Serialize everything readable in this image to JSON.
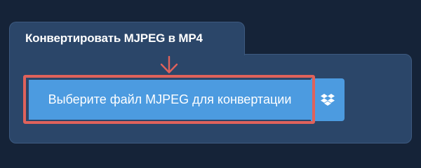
{
  "converter": {
    "title": "Конвертировать MJPEG в MP4",
    "choose_file_label": "Выберите файл MJPEG для конвертации",
    "dropbox_icon": "dropbox-icon",
    "arrow_icon": "arrow-down-icon"
  },
  "colors": {
    "page_background": "#152338",
    "panel_background": "#2b4669",
    "button_background": "#4c9be0",
    "highlight_border": "#e0625b"
  }
}
